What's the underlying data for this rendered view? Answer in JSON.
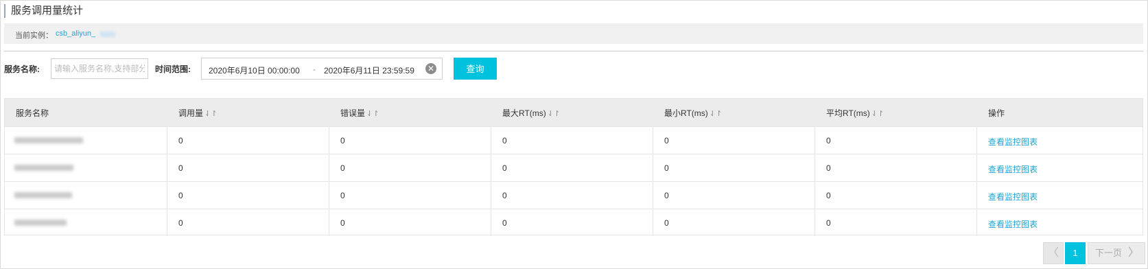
{
  "header": {
    "title": "服务调用量统计"
  },
  "instance": {
    "label": "当前实例：",
    "value": "csb_aliyun_"
  },
  "filters": {
    "service_label": "服务名称:",
    "service_placeholder": "请输入服务名称,支持部分",
    "time_label": "时间范围:",
    "start": "2020年6月10日 00:00:00",
    "separator": "-",
    "end": "2020年6月11日 23:59:59",
    "query_label": "查询"
  },
  "table": {
    "columns": [
      "服务名称",
      "调用量",
      "错误量",
      "最大RT(ms)",
      "最小RT(ms)",
      "平均RT(ms)",
      "操作"
    ],
    "rows": [
      {
        "calls": "0",
        "errors": "0",
        "max_rt": "0",
        "min_rt": "0",
        "avg_rt": "0",
        "action": "查看监控图表"
      },
      {
        "calls": "0",
        "errors": "0",
        "max_rt": "0",
        "min_rt": "0",
        "avg_rt": "0",
        "action": "查看监控图表"
      },
      {
        "calls": "0",
        "errors": "0",
        "max_rt": "0",
        "min_rt": "0",
        "avg_rt": "0",
        "action": "查看监控图表"
      },
      {
        "calls": "0",
        "errors": "0",
        "max_rt": "0",
        "min_rt": "0",
        "avg_rt": "0",
        "action": "查看监控图表"
      }
    ]
  },
  "pagination": {
    "current": "1",
    "next_label": "下一页"
  },
  "colors": {
    "accent": "#00c1de",
    "link": "#1ea5d8",
    "header_bg": "#ececec"
  },
  "icons": {
    "sort": "sort-arrows-icon",
    "clear": "clear-circle-icon",
    "prev": "chevron-left-icon",
    "next": "chevron-right-icon"
  }
}
